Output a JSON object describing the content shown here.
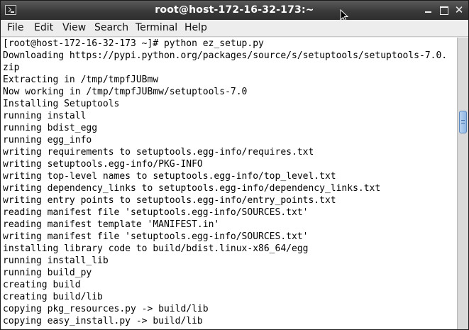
{
  "window": {
    "title": "root@host-172-16-32-173:~",
    "icon": "terminal-icon",
    "controls": {
      "minimize": "minimize-icon",
      "maximize": "maximize-icon",
      "close": "✕"
    }
  },
  "menu": {
    "items": [
      "File",
      "Edit",
      "View",
      "Search",
      "Terminal",
      "Help"
    ]
  },
  "terminal": {
    "lines": [
      "[root@host-172-16-32-173 ~]# python ez_setup.py",
      "Downloading https://pypi.python.org/packages/source/s/setuptools/setuptools-7.0.",
      "zip",
      "Extracting in /tmp/tmpfJUBmw",
      "Now working in /tmp/tmpfJUBmw/setuptools-7.0",
      "Installing Setuptools",
      "running install",
      "running bdist_egg",
      "running egg_info",
      "writing requirements to setuptools.egg-info/requires.txt",
      "writing setuptools.egg-info/PKG-INFO",
      "writing top-level names to setuptools.egg-info/top_level.txt",
      "writing dependency_links to setuptools.egg-info/dependency_links.txt",
      "writing entry points to setuptools.egg-info/entry_points.txt",
      "reading manifest file 'setuptools.egg-info/SOURCES.txt'",
      "reading manifest template 'MANIFEST.in'",
      "writing manifest file 'setuptools.egg-info/SOURCES.txt'",
      "installing library code to build/bdist.linux-x86_64/egg",
      "running install_lib",
      "running build_py",
      "creating build",
      "creating build/lib",
      "copying pkg_resources.py -> build/lib",
      "copying easy_install.py -> build/lib"
    ]
  },
  "colors": {
    "titlebar": "#3a3a3a",
    "terminal_bg": "#ffffff",
    "terminal_fg": "#000000",
    "scroll_thumb": "#8fb6e2"
  }
}
